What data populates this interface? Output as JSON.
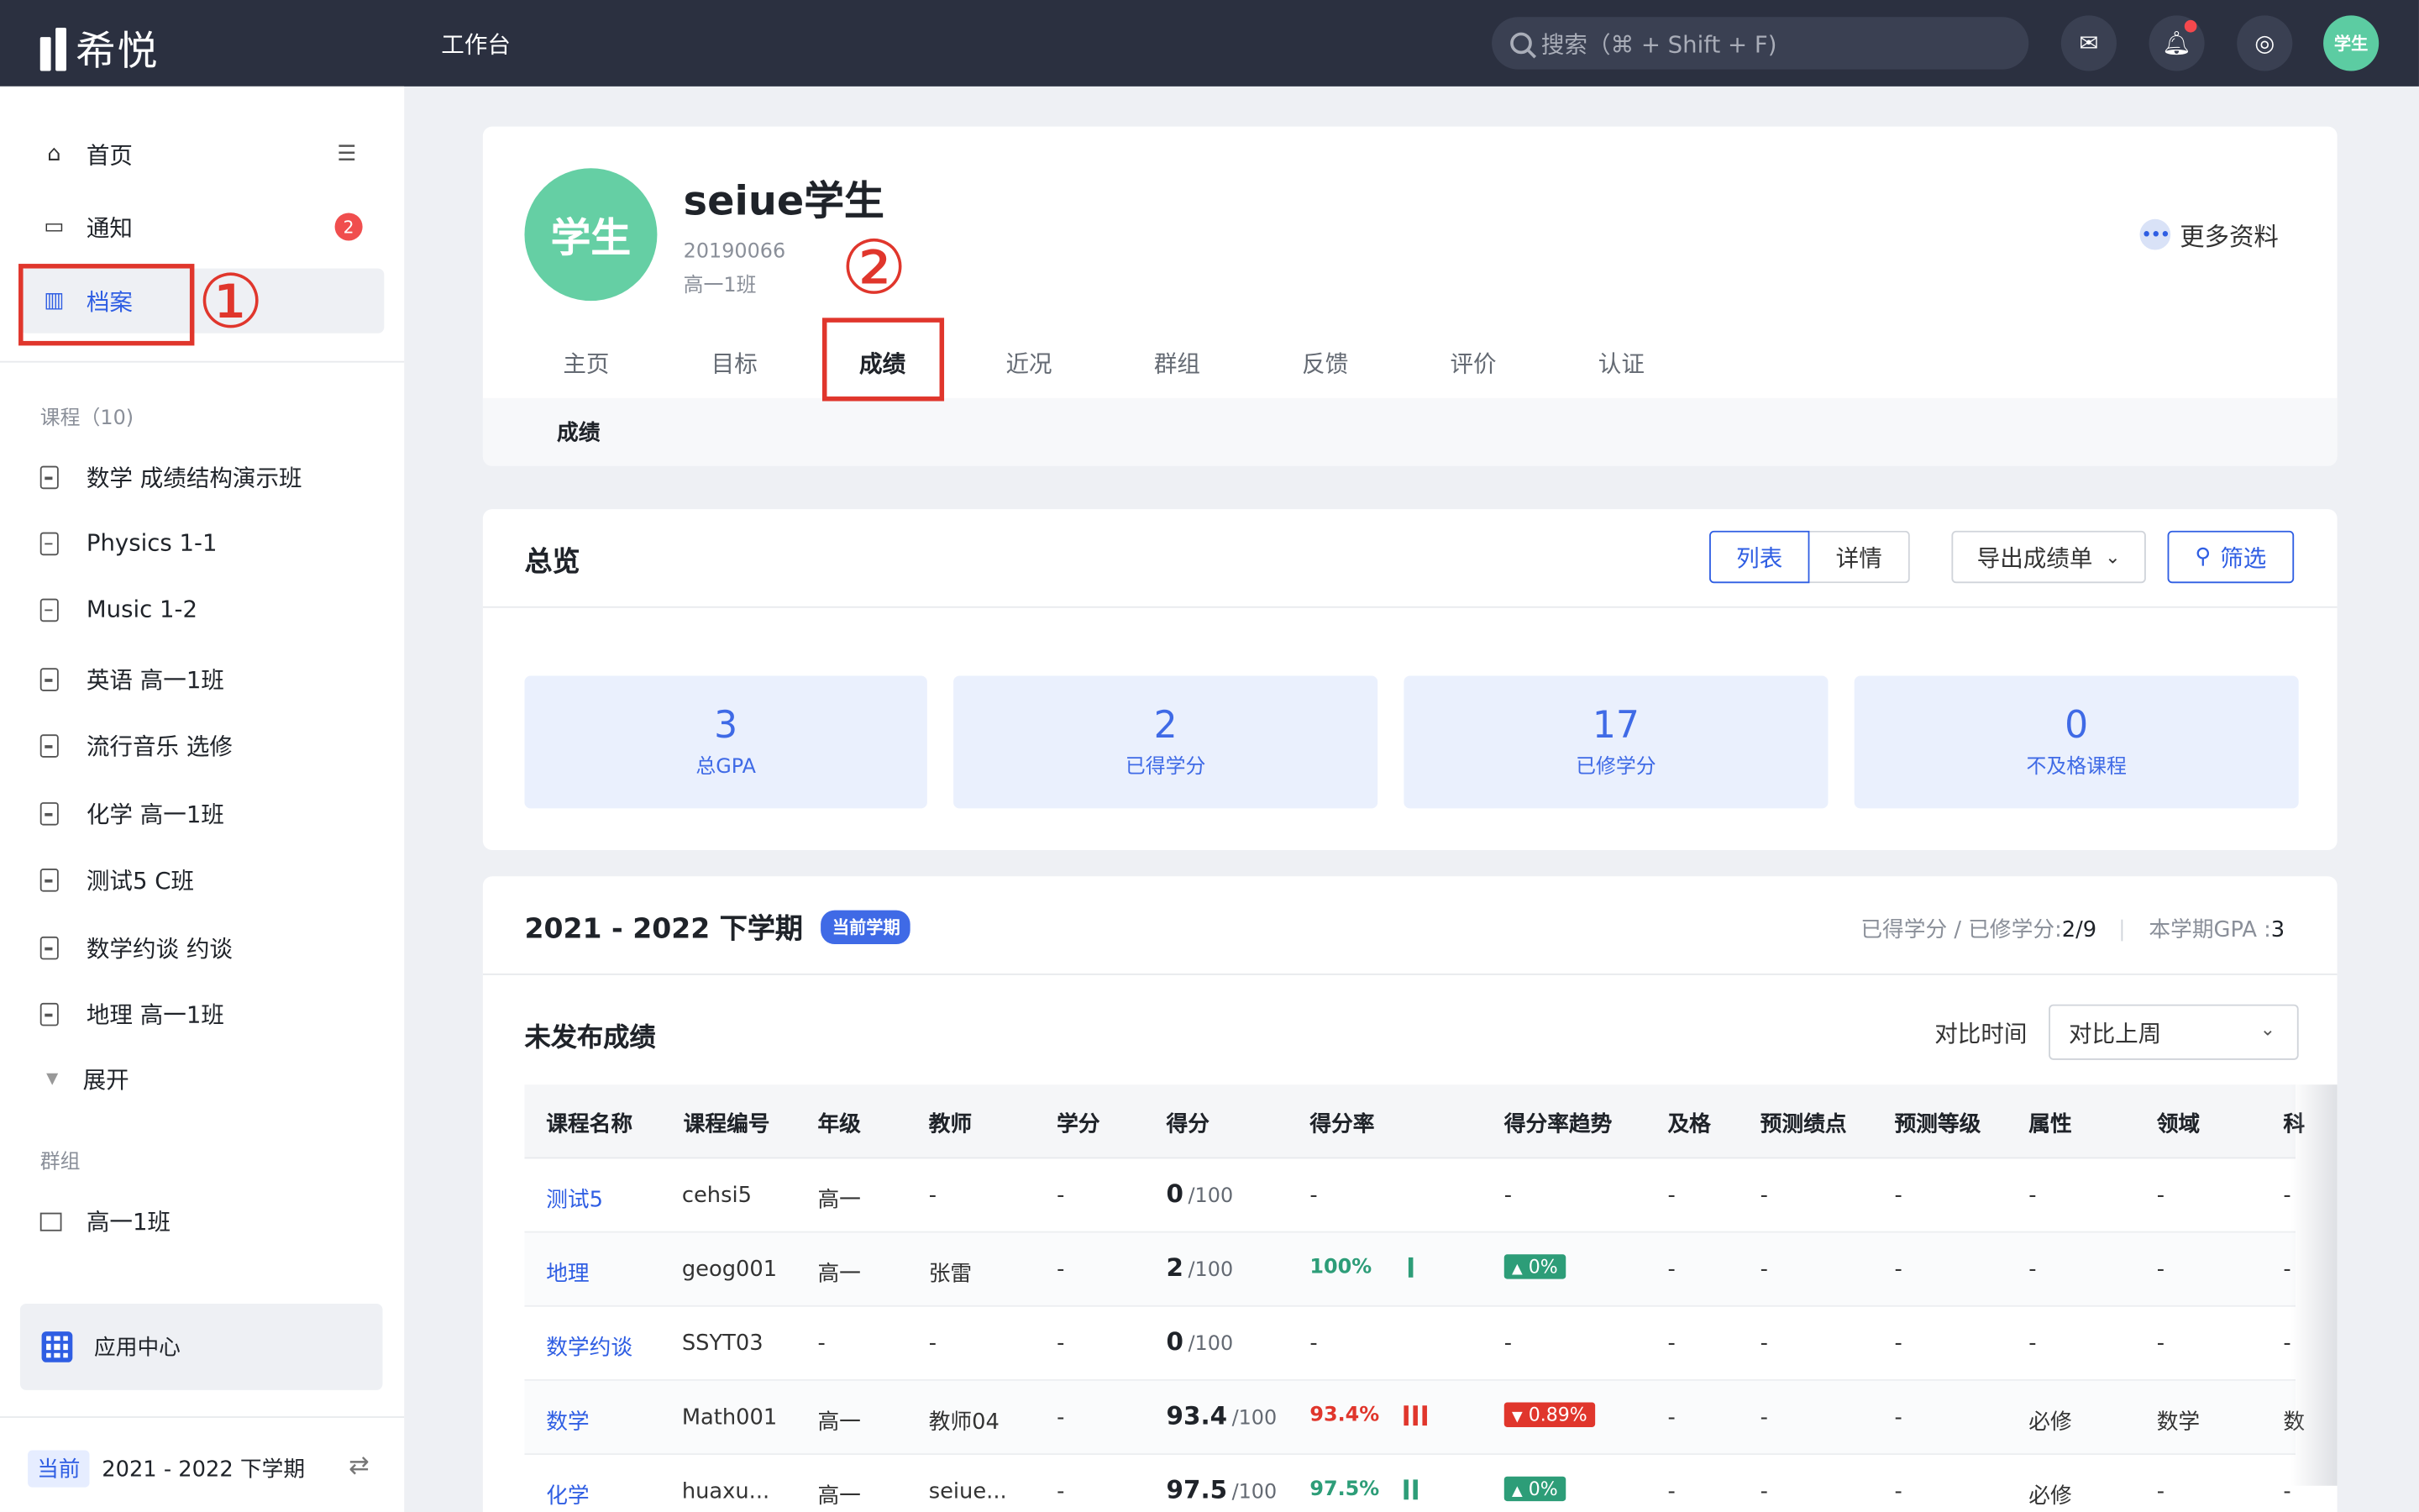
{
  "topbar": {
    "logo": "希悦",
    "workbench": "工作台",
    "search_placeholder": "搜索（⌘ + Shift + F)",
    "avatar": "学生"
  },
  "sidebar": {
    "nav": [
      {
        "label": "首页"
      },
      {
        "label": "通知",
        "badge": "2"
      },
      {
        "label": "档案"
      }
    ],
    "courses_label": "课程（10)",
    "courses": [
      "数学 成绩结构演示班",
      "Physics 1-1",
      "Music 1-2",
      "英语 高一1班",
      "流行音乐 选修",
      "化学 高一1班",
      "测试5 C班",
      "数学约谈 约谈",
      "地理 高一1班"
    ],
    "expand": "展开",
    "groups_label": "群组",
    "groups": [
      "高一1班"
    ],
    "app_center": "应用中心",
    "term_tag": "当前",
    "term": "2021 - 2022 下学期"
  },
  "annotations": {
    "one": "①",
    "two": "②"
  },
  "profile": {
    "avatar": "学生",
    "name": "seiue学生",
    "id": "20190066",
    "class": "高一1班",
    "more": "更多资料",
    "tabs": [
      "主页",
      "目标",
      "成绩",
      "近况",
      "群组",
      "反馈",
      "评价",
      "认证"
    ],
    "subtab": "成绩"
  },
  "overview": {
    "title": "总览",
    "btn_list": "列表",
    "btn_detail": "详情",
    "btn_export": "导出成绩单",
    "btn_filter": "筛选",
    "stats": [
      {
        "value": "3",
        "label": "总GPA"
      },
      {
        "value": "2",
        "label": "已得学分"
      },
      {
        "value": "17",
        "label": "已修学分"
      },
      {
        "value": "0",
        "label": "不及格课程"
      }
    ]
  },
  "term": {
    "title": "2021 - 2022 下学期",
    "tag": "当前学期",
    "credits_label": "已得学分 / 已修学分:",
    "credits": "2/9",
    "gpa_label": "本学期GPA :",
    "gpa": "3",
    "unpublished": "未发布成绩",
    "compare_label": "对比时间",
    "compare_value": "对比上周"
  },
  "table": {
    "headers": [
      "课程名称",
      "课程编号",
      "年级",
      "教师",
      "学分",
      "得分",
      "得分率",
      "得分率趋势",
      "及格",
      "预测绩点",
      "预测等级",
      "属性",
      "领域",
      "科"
    ],
    "rows": [
      {
        "name": "测试5",
        "code": "cehsi5",
        "grade": "高一",
        "teacher": "-",
        "credit": "-",
        "score": "0",
        "total": "/100",
        "rate": "-",
        "trend": "-",
        "pass": "-",
        "gp": "-",
        "level": "-",
        "attr": "-",
        "field": "-",
        "last": "-"
      },
      {
        "name": "地理",
        "code": "geog001",
        "grade": "高一",
        "teacher": "张雷",
        "credit": "-",
        "score": "2",
        "total": "/100",
        "rate": "100%",
        "trend": "0%",
        "pass": "-",
        "gp": "-",
        "level": "-",
        "attr": "-",
        "field": "-",
        "last": "-"
      },
      {
        "name": "数学约谈",
        "code": "SSYT03",
        "grade": "-",
        "teacher": "-",
        "credit": "-",
        "score": "0",
        "total": "/100",
        "rate": "-",
        "trend": "-",
        "pass": "-",
        "gp": "-",
        "level": "-",
        "attr": "-",
        "field": "-",
        "last": "-"
      },
      {
        "name": "数学",
        "code": "Math001",
        "grade": "高一",
        "teacher": "教师04",
        "credit": "-",
        "score": "93.4",
        "total": "/100",
        "rate": "93.4%",
        "trend": "0.89%",
        "pass": "-",
        "gp": "-",
        "level": "-",
        "attr": "必修",
        "field": "数学",
        "last": "数"
      },
      {
        "name": "化学",
        "code": "huaxu...",
        "grade": "高一",
        "teacher": "seiue...",
        "credit": "-",
        "score": "97.5",
        "total": "/100",
        "rate": "97.5%",
        "trend": "0%",
        "pass": "-",
        "gp": "-",
        "level": "-",
        "attr": "必修",
        "field": "-",
        "last": "-"
      }
    ]
  },
  "colors": {
    "accent": "#2f5ee3",
    "topbar": "#2b3040",
    "green": "#2d9d78",
    "red": "#e0362c",
    "annotation": "#e0362c"
  }
}
